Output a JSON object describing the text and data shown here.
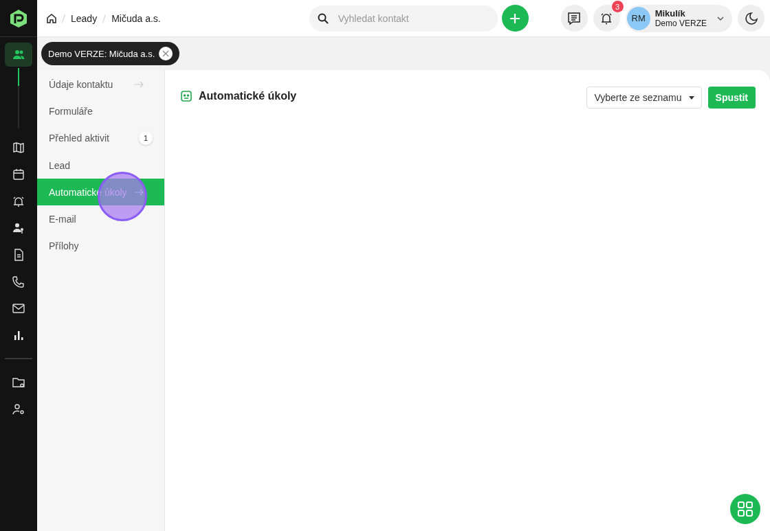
{
  "breadcrumb": [
    "Leady",
    "Mičuda a.s."
  ],
  "search": {
    "placeholder": "Vyhledat kontakt"
  },
  "notifications": {
    "count": "3"
  },
  "user": {
    "initials": "RM",
    "name": "Mikulík",
    "subtitle": "Demo VERZE"
  },
  "sidebar": {
    "items": [
      {
        "kind": "people",
        "selected": true
      },
      {
        "kind": "map",
        "selected": false
      },
      {
        "kind": "calendar",
        "selected": false
      },
      {
        "kind": "alarm",
        "selected": false
      },
      {
        "kind": "userkey",
        "selected": false
      },
      {
        "kind": "document",
        "selected": false
      },
      {
        "kind": "phone",
        "selected": false
      },
      {
        "kind": "mail",
        "selected": false
      },
      {
        "kind": "chart",
        "selected": false
      }
    ],
    "bottom_items": [
      {
        "kind": "folder",
        "selected": false
      },
      {
        "kind": "usergear",
        "selected": false
      }
    ]
  },
  "chip": {
    "label": "Demo VERZE: Mičuda a.s."
  },
  "menu": [
    {
      "label": "Údaje kontaktu",
      "selected": false,
      "arrow": true
    },
    {
      "label": "Formuláře",
      "selected": false,
      "arrow": false
    },
    {
      "label": "Přehled aktivit",
      "selected": false,
      "arrow": false,
      "badge": "1"
    },
    {
      "label": "Lead",
      "selected": false,
      "arrow": false
    },
    {
      "label": "Automatické úkoly",
      "selected": true,
      "arrow": true
    },
    {
      "label": "E-mail",
      "selected": false,
      "arrow": false
    },
    {
      "label": "Přílohy",
      "selected": false,
      "arrow": false
    }
  ],
  "panel": {
    "title": "Automatické úkoly",
    "select": "Vyberte ze seznamu",
    "button": "Spustit"
  }
}
